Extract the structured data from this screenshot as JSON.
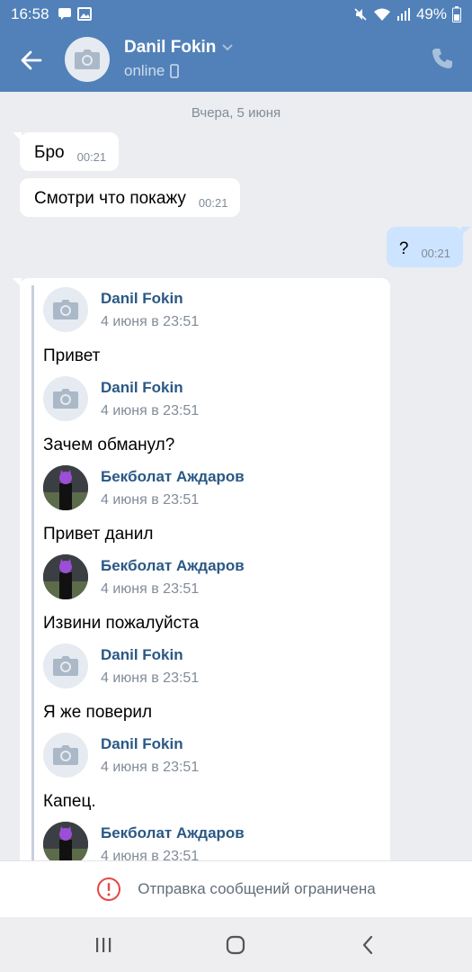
{
  "status_bar": {
    "time": "16:58",
    "battery": "49%"
  },
  "header": {
    "name": "Danil Fokin",
    "status": "online"
  },
  "chat": {
    "date_separator": "Вчера, 5 июня",
    "messages": [
      {
        "text": "Бро",
        "time": "00:21"
      },
      {
        "text": "Смотри что покажу",
        "time": "00:21"
      },
      {
        "text": "?",
        "time": "00:21"
      }
    ],
    "forwarded": [
      {
        "author": "Danil Fokin",
        "date": "4 июня в 23:51",
        "text": "Привет"
      },
      {
        "author": "Danil Fokin",
        "date": "4 июня в 23:51",
        "text": "Зачем обманул?"
      },
      {
        "author": "Бекболат Аждаров",
        "date": "4 июня в 23:51",
        "text": "Привет данил"
      },
      {
        "author": "Бекболат Аждаров",
        "date": "4 июня в 23:51",
        "text": "Извини пожалуйста"
      },
      {
        "author": "Danil Fokin",
        "date": "4 июня в 23:51",
        "text": "Я же поверил"
      },
      {
        "author": "Danil Fokin",
        "date": "4 июня в 23:51",
        "text": "Капец."
      },
      {
        "author": "Бекболат Аждаров",
        "date": "4 июня в 23:51",
        "text": ""
      }
    ]
  },
  "restriction": {
    "text": "Отправка сообщений ограничена"
  },
  "colors": {
    "header": "#5181b8",
    "accent": "#2a5885",
    "outgoing": "#cce4ff",
    "warning": "#e64646"
  },
  "icons": [
    "back-arrow-icon",
    "camera-icon",
    "chevron-down-icon",
    "phone-icon",
    "mobile-icon",
    "warning-icon",
    "recent-apps-icon",
    "home-icon",
    "nav-back-icon"
  ]
}
